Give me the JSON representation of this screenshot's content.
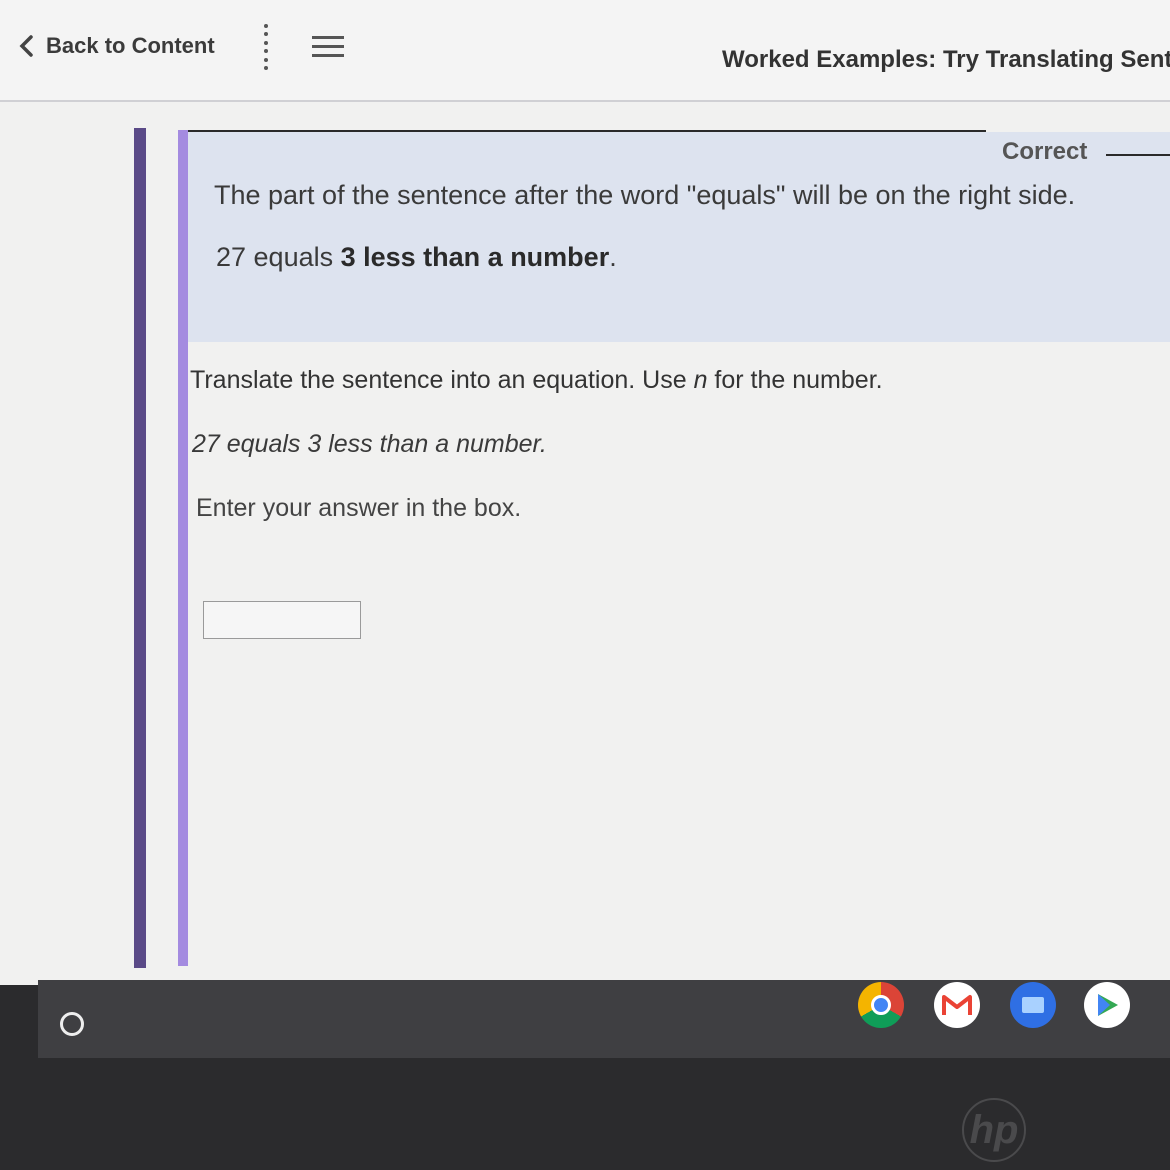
{
  "header": {
    "back_label": "Back to Content",
    "title": "Worked Examples: Try Translating Senten"
  },
  "feedback": {
    "status": "Correct",
    "explanation": "The part of the sentence after the word \"equals\" will be on the right side.",
    "example_prefix": "27 equals ",
    "example_bold": "3 less than a number",
    "example_suffix": "."
  },
  "question": {
    "prompt_before": "Translate the sentence into an equation. Use ",
    "prompt_variable": "n",
    "prompt_after": " for the number.",
    "sentence": "27 equals 3 less than a number.",
    "instruction": "Enter your answer in the box.",
    "answer_value": ""
  },
  "shelf": {
    "apps": [
      "chrome-icon",
      "gmail-icon",
      "files-icon",
      "play-store-icon"
    ]
  },
  "hardware": {
    "logo_text": "hp"
  }
}
